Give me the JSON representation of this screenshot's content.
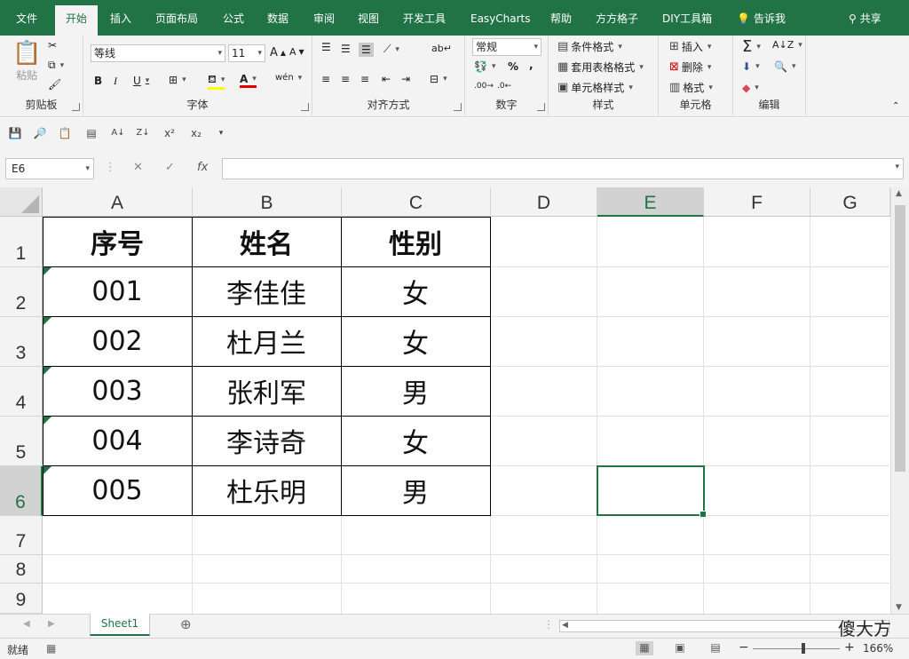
{
  "ribbon_tabs": [
    "文件",
    "开始",
    "插入",
    "页面布局",
    "公式",
    "数据",
    "审阅",
    "视图",
    "开发工具",
    "EasyCharts",
    "帮助",
    "方方格子",
    "DIY工具箱"
  ],
  "active_tab": "开始",
  "tell_me": "告诉我",
  "share": "共享",
  "clipboard": {
    "paste": "粘贴",
    "label": "剪贴板"
  },
  "font": {
    "name": "等线",
    "size": "11",
    "label": "字体",
    "phonetic": "wén"
  },
  "alignment": {
    "label": "对齐方式"
  },
  "number": {
    "format": "常规",
    "percent": "%",
    "comma": ",",
    "label": "数字"
  },
  "styles": {
    "conditional": "条件格式",
    "table": "套用表格格式",
    "cell": "单元格样式",
    "label": "样式"
  },
  "cells": {
    "insert": "插入",
    "delete": "删除",
    "format": "格式",
    "label": "单元格"
  },
  "editing": {
    "label": "编辑"
  },
  "name_box": "E6",
  "fx": "fx",
  "columns": [
    "A",
    "B",
    "C",
    "D",
    "E",
    "F",
    "G"
  ],
  "selected_column": "E",
  "rows": [
    "1",
    "2",
    "3",
    "4",
    "5",
    "6",
    "7",
    "8",
    "9"
  ],
  "selected_row": "6",
  "table": {
    "headers": [
      "序号",
      "姓名",
      "性别"
    ],
    "rows": [
      [
        "001",
        "李佳佳",
        "女"
      ],
      [
        "002",
        "杜月兰",
        "女"
      ],
      [
        "003",
        "张利军",
        "男"
      ],
      [
        "004",
        "李诗奇",
        "女"
      ],
      [
        "005",
        "杜乐明",
        "男"
      ]
    ]
  },
  "sheet_tab": "Sheet1",
  "watermark": "傻大方",
  "status": {
    "ready": "就绪",
    "zoom": "166%"
  },
  "colors": {
    "excel_green": "#217346"
  }
}
